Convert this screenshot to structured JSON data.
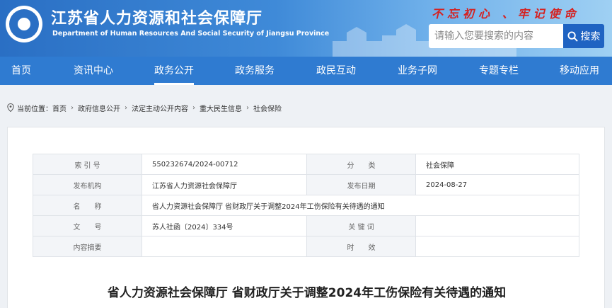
{
  "header": {
    "title_cn": "江苏省人力资源和社会保障厅",
    "title_en": "Department of Human Resources And Social Security of Jiangsu Province",
    "slogan": "不忘初心 、牢记使命",
    "search_placeholder": "请输入您要搜索的内容",
    "search_label": "搜索",
    "colors": {
      "brand": "#2a6fc4",
      "nav": "#2f7bd1",
      "slogan": "#d6201f",
      "search_button": "#1f63c2"
    }
  },
  "nav": [
    {
      "label": "首页"
    },
    {
      "label": "资讯中心"
    },
    {
      "label": "政务公开",
      "active": true
    },
    {
      "label": "政务服务"
    },
    {
      "label": "政民互动"
    },
    {
      "label": "业务子网"
    },
    {
      "label": "专题专栏"
    },
    {
      "label": "移动应用"
    }
  ],
  "breadcrumb": {
    "prefix": "当前位置：",
    "items": [
      "首页",
      "政府信息公开",
      "法定主动公开内容",
      "重大民生信息",
      "社会保险"
    ]
  },
  "meta": {
    "rows": [
      {
        "k1": "索 引 号",
        "v1": "550232674/2024-00712",
        "k2": "分　　类",
        "v2": "社会保障"
      },
      {
        "k1": "发布机构",
        "v1": "江苏省人力资源社会保障厅",
        "k2": "发布日期",
        "v2": "2024-08-27"
      },
      {
        "k1": "名　　称",
        "v1": "省人力资源社会保障厅 省财政厅关于调整2024年工伤保险有关待遇的通知"
      },
      {
        "k1": "文　　号",
        "v1": "苏人社函〔2024〕334号",
        "k2": "关 键 词",
        "v2": ""
      },
      {
        "k1": "内容摘要",
        "v1": "",
        "k2": "时　　效",
        "v2": ""
      }
    ]
  },
  "article": {
    "title": "省人力资源社会保障厅 省财政厅关于调整2024年工伤保险有关待遇的通知"
  }
}
